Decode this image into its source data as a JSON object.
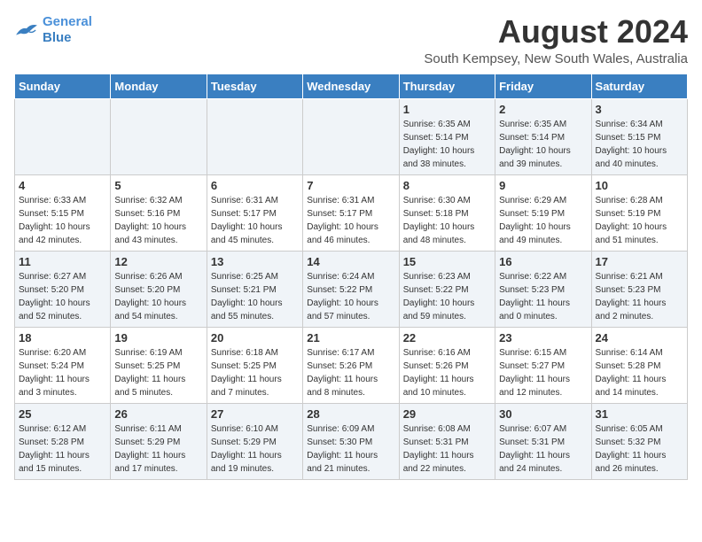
{
  "logo": {
    "line1": "General",
    "line2": "Blue"
  },
  "title": "August 2024",
  "location": "South Kempsey, New South Wales, Australia",
  "weekdays": [
    "Sunday",
    "Monday",
    "Tuesday",
    "Wednesday",
    "Thursday",
    "Friday",
    "Saturday"
  ],
  "weeks": [
    [
      {
        "day": "",
        "info": ""
      },
      {
        "day": "",
        "info": ""
      },
      {
        "day": "",
        "info": ""
      },
      {
        "day": "",
        "info": ""
      },
      {
        "day": "1",
        "info": "Sunrise: 6:35 AM\nSunset: 5:14 PM\nDaylight: 10 hours\nand 38 minutes."
      },
      {
        "day": "2",
        "info": "Sunrise: 6:35 AM\nSunset: 5:14 PM\nDaylight: 10 hours\nand 39 minutes."
      },
      {
        "day": "3",
        "info": "Sunrise: 6:34 AM\nSunset: 5:15 PM\nDaylight: 10 hours\nand 40 minutes."
      }
    ],
    [
      {
        "day": "4",
        "info": "Sunrise: 6:33 AM\nSunset: 5:15 PM\nDaylight: 10 hours\nand 42 minutes."
      },
      {
        "day": "5",
        "info": "Sunrise: 6:32 AM\nSunset: 5:16 PM\nDaylight: 10 hours\nand 43 minutes."
      },
      {
        "day": "6",
        "info": "Sunrise: 6:31 AM\nSunset: 5:17 PM\nDaylight: 10 hours\nand 45 minutes."
      },
      {
        "day": "7",
        "info": "Sunrise: 6:31 AM\nSunset: 5:17 PM\nDaylight: 10 hours\nand 46 minutes."
      },
      {
        "day": "8",
        "info": "Sunrise: 6:30 AM\nSunset: 5:18 PM\nDaylight: 10 hours\nand 48 minutes."
      },
      {
        "day": "9",
        "info": "Sunrise: 6:29 AM\nSunset: 5:19 PM\nDaylight: 10 hours\nand 49 minutes."
      },
      {
        "day": "10",
        "info": "Sunrise: 6:28 AM\nSunset: 5:19 PM\nDaylight: 10 hours\nand 51 minutes."
      }
    ],
    [
      {
        "day": "11",
        "info": "Sunrise: 6:27 AM\nSunset: 5:20 PM\nDaylight: 10 hours\nand 52 minutes."
      },
      {
        "day": "12",
        "info": "Sunrise: 6:26 AM\nSunset: 5:20 PM\nDaylight: 10 hours\nand 54 minutes."
      },
      {
        "day": "13",
        "info": "Sunrise: 6:25 AM\nSunset: 5:21 PM\nDaylight: 10 hours\nand 55 minutes."
      },
      {
        "day": "14",
        "info": "Sunrise: 6:24 AM\nSunset: 5:22 PM\nDaylight: 10 hours\nand 57 minutes."
      },
      {
        "day": "15",
        "info": "Sunrise: 6:23 AM\nSunset: 5:22 PM\nDaylight: 10 hours\nand 59 minutes."
      },
      {
        "day": "16",
        "info": "Sunrise: 6:22 AM\nSunset: 5:23 PM\nDaylight: 11 hours\nand 0 minutes."
      },
      {
        "day": "17",
        "info": "Sunrise: 6:21 AM\nSunset: 5:23 PM\nDaylight: 11 hours\nand 2 minutes."
      }
    ],
    [
      {
        "day": "18",
        "info": "Sunrise: 6:20 AM\nSunset: 5:24 PM\nDaylight: 11 hours\nand 3 minutes."
      },
      {
        "day": "19",
        "info": "Sunrise: 6:19 AM\nSunset: 5:25 PM\nDaylight: 11 hours\nand 5 minutes."
      },
      {
        "day": "20",
        "info": "Sunrise: 6:18 AM\nSunset: 5:25 PM\nDaylight: 11 hours\nand 7 minutes."
      },
      {
        "day": "21",
        "info": "Sunrise: 6:17 AM\nSunset: 5:26 PM\nDaylight: 11 hours\nand 8 minutes."
      },
      {
        "day": "22",
        "info": "Sunrise: 6:16 AM\nSunset: 5:26 PM\nDaylight: 11 hours\nand 10 minutes."
      },
      {
        "day": "23",
        "info": "Sunrise: 6:15 AM\nSunset: 5:27 PM\nDaylight: 11 hours\nand 12 minutes."
      },
      {
        "day": "24",
        "info": "Sunrise: 6:14 AM\nSunset: 5:28 PM\nDaylight: 11 hours\nand 14 minutes."
      }
    ],
    [
      {
        "day": "25",
        "info": "Sunrise: 6:12 AM\nSunset: 5:28 PM\nDaylight: 11 hours\nand 15 minutes."
      },
      {
        "day": "26",
        "info": "Sunrise: 6:11 AM\nSunset: 5:29 PM\nDaylight: 11 hours\nand 17 minutes."
      },
      {
        "day": "27",
        "info": "Sunrise: 6:10 AM\nSunset: 5:29 PM\nDaylight: 11 hours\nand 19 minutes."
      },
      {
        "day": "28",
        "info": "Sunrise: 6:09 AM\nSunset: 5:30 PM\nDaylight: 11 hours\nand 21 minutes."
      },
      {
        "day": "29",
        "info": "Sunrise: 6:08 AM\nSunset: 5:31 PM\nDaylight: 11 hours\nand 22 minutes."
      },
      {
        "day": "30",
        "info": "Sunrise: 6:07 AM\nSunset: 5:31 PM\nDaylight: 11 hours\nand 24 minutes."
      },
      {
        "day": "31",
        "info": "Sunrise: 6:05 AM\nSunset: 5:32 PM\nDaylight: 11 hours\nand 26 minutes."
      }
    ]
  ]
}
